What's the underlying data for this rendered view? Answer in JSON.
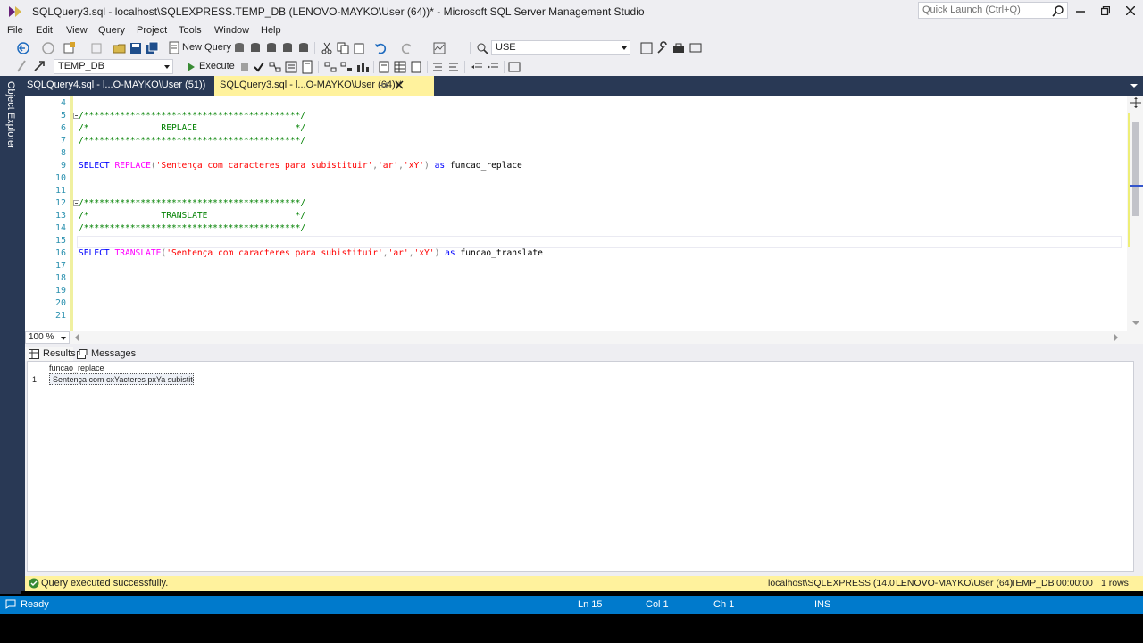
{
  "window": {
    "title": "SQLQuery3.sql - localhost\\SQLEXPRESS.TEMP_DB (LENOVO-MAYKO\\User (64))* - Microsoft SQL Server Management Studio",
    "quick_launch_placeholder": "Quick Launch (Ctrl+Q)"
  },
  "menu": {
    "items": [
      "File",
      "Edit",
      "View",
      "Query",
      "Project",
      "Tools",
      "Window",
      "Help"
    ]
  },
  "toolbar": {
    "new_query_label": "New Query",
    "use_combo_value": "USE",
    "database_combo_value": "TEMP_DB",
    "execute_label": "Execute"
  },
  "left_rail": {
    "object_explorer_label": "Object Explorer"
  },
  "doc_tabs": [
    {
      "label": "SQLQuery4.sql - l...O-MAYKO\\User (51))",
      "active": false
    },
    {
      "label": "SQLQuery3.sql - l...O-MAYKO\\User (64))*",
      "active": true
    }
  ],
  "editor": {
    "line_numbers": [
      "4",
      "5",
      "6",
      "7",
      "8",
      "9",
      "10",
      "11",
      "12",
      "13",
      "14",
      "15",
      "16",
      "17",
      "18",
      "19",
      "20",
      "21"
    ],
    "comment_border": "/******************************************/",
    "replace_comment": "/*              REPLACE                   */",
    "translate_comment": "/*              TRANSLATE                 */",
    "line9": {
      "select": "SELECT ",
      "fn": "REPLACE",
      "open": "(",
      "arg1": "'Sentença com caracteres para subistituir'",
      "c1": ",",
      "arg2": "'ar'",
      "c2": ",",
      "arg3": "'xY'",
      "close": ") ",
      "as": "as",
      "alias": " funcao_replace"
    },
    "line16": {
      "select": "SELECT ",
      "fn": "TRANSLATE",
      "open": "(",
      "arg1": "'Sentença com caracteres para subistituir'",
      "c1": ",",
      "arg2": "'ar'",
      "c2": ",",
      "arg3": "'xY'",
      "close": ") ",
      "as": "as",
      "alias": " funcao_translate"
    },
    "zoom": "100 %"
  },
  "results": {
    "tabs": {
      "results": "Results",
      "messages": "Messages"
    },
    "column_header": "funcao_replace",
    "row_number": "1",
    "cell_value": "Sentença com cxYacteres pxYa subistituir"
  },
  "query_status": {
    "message": "Query executed successfully.",
    "server": "localhost\\SQLEXPRESS (14.0 ...",
    "user": "LENOVO-MAYKO\\User (64)",
    "database": "TEMP_DB",
    "elapsed": "00:00:00",
    "rows": "1 rows"
  },
  "statusbar": {
    "state": "Ready",
    "ln": "Ln 15",
    "col": "Col 1",
    "ch": "Ch 1",
    "mode": "INS"
  }
}
